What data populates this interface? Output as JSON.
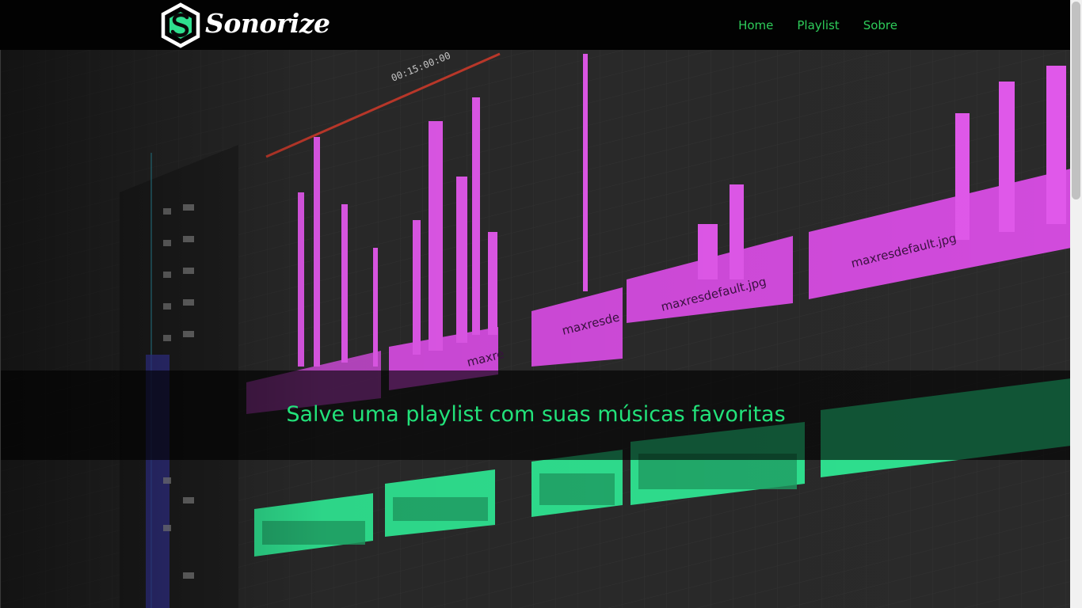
{
  "brand": {
    "name": "Sonorize",
    "logo_icon": "hexagon-s-logo-icon"
  },
  "nav": {
    "items": [
      {
        "label": "Home"
      },
      {
        "label": "Playlist"
      },
      {
        "label": "Sobre"
      }
    ],
    "link_color": "#2ecc5a"
  },
  "hero": {
    "tagline": "Salve uma playlist com suas músicas favoritas",
    "tagline_color": "#22e27a",
    "image_subject": "audio-editing-timeline-image",
    "image_labels": [
      "00:15:00:00",
      "maxresde",
      "maxresdefault.jpg",
      "max",
      "maxre",
      "maxresdefault.jpg"
    ]
  },
  "colors": {
    "navbar": "#020202",
    "clip_magenta": "#d14bdc",
    "clip_green": "#2fe08f"
  }
}
